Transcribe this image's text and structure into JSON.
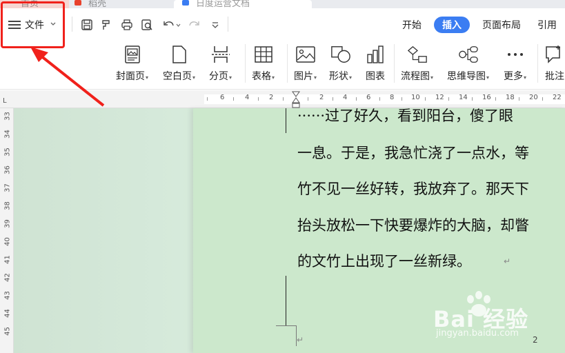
{
  "title_tabs": [
    {
      "label": "首页",
      "color": "#d9534f"
    },
    {
      "label": "稻壳",
      "color": "#e8412c"
    },
    {
      "label": "日度运营文档",
      "color": "#3b7df2"
    }
  ],
  "file_menu": {
    "label": "文件",
    "icon": "hamburger-icon"
  },
  "quick_access": [
    "save-icon",
    "format-painter-icon",
    "print-icon",
    "print-preview-icon",
    "undo-icon",
    "redo-icon",
    "more-icon"
  ],
  "ribbon_tabs": [
    {
      "label": "开始",
      "active": false
    },
    {
      "label": "插入",
      "active": true
    },
    {
      "label": "页面布局",
      "active": false
    },
    {
      "label": "引用",
      "active": false
    }
  ],
  "ribbon_buttons": [
    {
      "label": "封面页",
      "dropdown": true,
      "icon": "cover-page-icon"
    },
    {
      "label": "空白页",
      "dropdown": true,
      "icon": "blank-page-icon"
    },
    {
      "label": "分页",
      "dropdown": true,
      "icon": "page-break-icon"
    },
    {
      "label": "表格",
      "dropdown": true,
      "icon": "table-icon"
    },
    {
      "label": "图片",
      "dropdown": true,
      "icon": "picture-icon"
    },
    {
      "label": "形状",
      "dropdown": true,
      "icon": "shape-icon"
    },
    {
      "label": "图表",
      "dropdown": false,
      "icon": "chart-icon"
    },
    {
      "label": "流程图",
      "dropdown": true,
      "icon": "flowchart-icon"
    },
    {
      "label": "思维导图",
      "dropdown": true,
      "icon": "mindmap-icon"
    },
    {
      "label": "更多",
      "dropdown": true,
      "icon": "more-dots-icon"
    },
    {
      "label": "批注",
      "dropdown": false,
      "icon": "comment-icon"
    }
  ],
  "ruler": {
    "corner": "L",
    "numbers": [
      "6",
      "4",
      "2",
      "2",
      "4",
      "6",
      "8",
      "10",
      "12",
      "14",
      "16",
      "18",
      "20",
      "22"
    ]
  },
  "vruler": [
    "33",
    "34",
    "35",
    "36",
    "37",
    "38",
    "39",
    "40",
    "41",
    "42",
    "43",
    "44",
    "45"
  ],
  "document": {
    "lines": [
      "······过了好久，看到阳台，傻了眼",
      "一息。于是，我急忙浇了一点水，等",
      "竹不见一丝好转，我放弃了。那天下",
      "抬头放松一下快要爆炸的大脑，却瞥",
      "的文竹上出现了一丝新绿。"
    ],
    "page_number": "2"
  },
  "watermark": {
    "brand": "Bai 经验",
    "sub": "jingyan.baidu.com"
  },
  "colors": {
    "accent": "#3b7df2",
    "annotation": "#f0211b",
    "page_bg": "#cce8cc"
  }
}
